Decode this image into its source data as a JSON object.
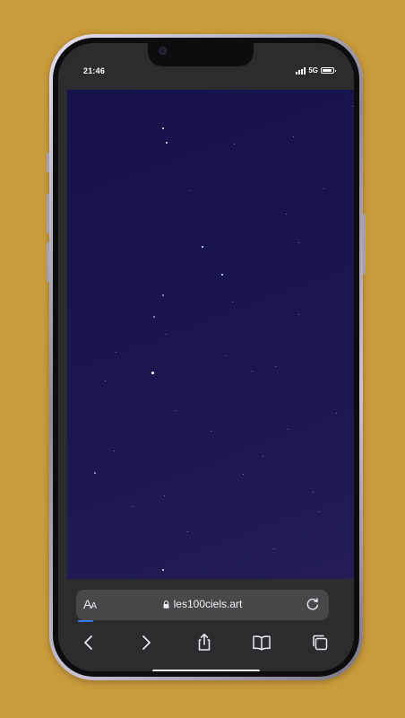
{
  "status_bar": {
    "time": "21:46",
    "network": "5G",
    "signal_bars": 4,
    "battery_level": 1.0
  },
  "browser": {
    "reader_button": {
      "big": "A",
      "small": "A"
    },
    "url": "les100ciels.art",
    "load_progress": 0.06,
    "nav_icons": [
      "back-icon",
      "forward-icon",
      "share-icon",
      "bookmarks-icon",
      "tabs-icon"
    ]
  },
  "web_page": {
    "background_color": "#18144c",
    "star_color": "#ffffff"
  },
  "colors": {
    "background": "#c99b3b",
    "browser_chrome": "#2c2c2f",
    "address_bar": "#48484b",
    "accent": "#3a7bf0"
  }
}
